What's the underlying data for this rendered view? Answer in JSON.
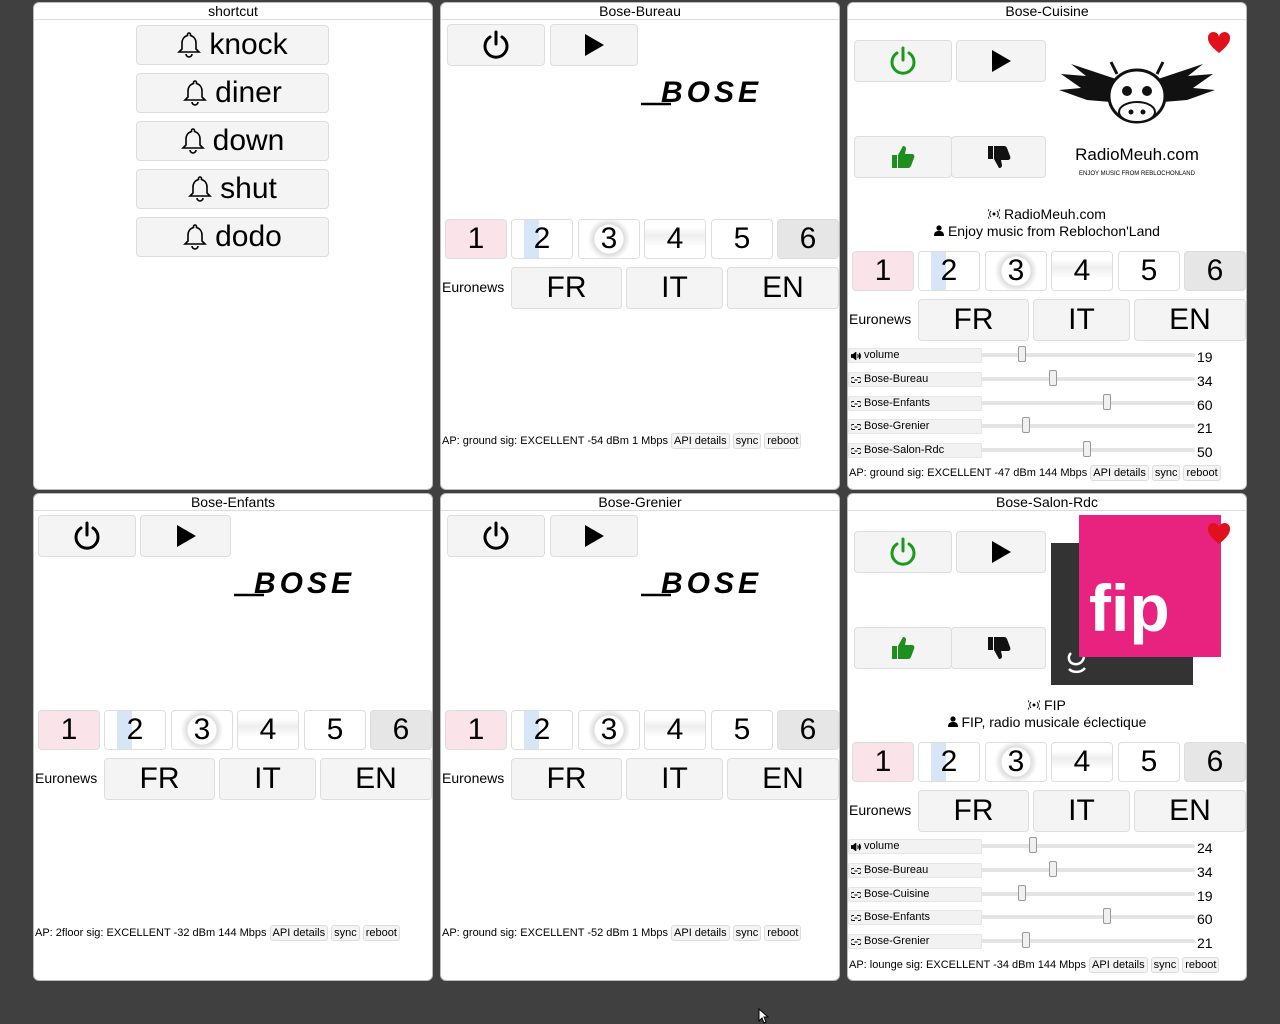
{
  "shortcut": {
    "title": "shortcut",
    "buttons": [
      {
        "label": "knock"
      },
      {
        "label": "diner"
      },
      {
        "label": "down"
      },
      {
        "label": "shut"
      },
      {
        "label": "dodo"
      }
    ]
  },
  "presets": [
    "1",
    "2",
    "3",
    "4",
    "5",
    "6"
  ],
  "euronews": {
    "label": "Euronews",
    "langs": [
      "FR",
      "IT",
      "EN"
    ]
  },
  "status_buttons": {
    "api": "API details",
    "sync": "sync",
    "reboot": "reboot"
  },
  "bose_bureau": {
    "title": "Bose-Bureau",
    "status": "AP: ground sig: EXCELLENT -54 dBm 1 Mbps"
  },
  "bose_cuisine": {
    "title": "Bose-Cuisine",
    "station": "RadioMeuh.com",
    "description": "Enjoy music from Reblochon'Land",
    "logo_text": "RadioMeuh.com",
    "logo_tagline": "ENJOY MUSIC FROM REBLOCHONLAND",
    "sliders": [
      {
        "label": "volume",
        "value": "19"
      },
      {
        "label": "Bose-Bureau",
        "value": "34"
      },
      {
        "label": "Bose-Enfants",
        "value": "60"
      },
      {
        "label": "Bose-Grenier",
        "value": "21"
      },
      {
        "label": "Bose-Salon-Rdc",
        "value": "50"
      }
    ],
    "status": "AP: ground sig: EXCELLENT -47 dBm 144 Mbps"
  },
  "bose_enfants": {
    "title": "Bose-Enfants",
    "status": "AP: 2floor sig: EXCELLENT -32 dBm 144 Mbps"
  },
  "bose_grenier": {
    "title": "Bose-Grenier",
    "status": "AP: ground sig: EXCELLENT -52 dBm 1 Mbps"
  },
  "bose_salon": {
    "title": "Bose-Salon-Rdc",
    "station": "FIP",
    "description": "FIP, radio musicale éclectique",
    "logo_text": "fip",
    "sliders": [
      {
        "label": "volume",
        "value": "24"
      },
      {
        "label": "Bose-Bureau",
        "value": "34"
      },
      {
        "label": "Bose-Cuisine",
        "value": "19"
      },
      {
        "label": "Bose-Enfants",
        "value": "60"
      },
      {
        "label": "Bose-Grenier",
        "value": "21"
      }
    ],
    "status": "AP: lounge sig: EXCELLENT -34 dBm 144 Mbps"
  },
  "bose_logo_text": "BOSE",
  "colors": {
    "background": "#404040",
    "power_on": "#1a9a1a",
    "like": "#1e8f1e",
    "heart": "#e0101c",
    "fip_pink": "#e8237f"
  }
}
